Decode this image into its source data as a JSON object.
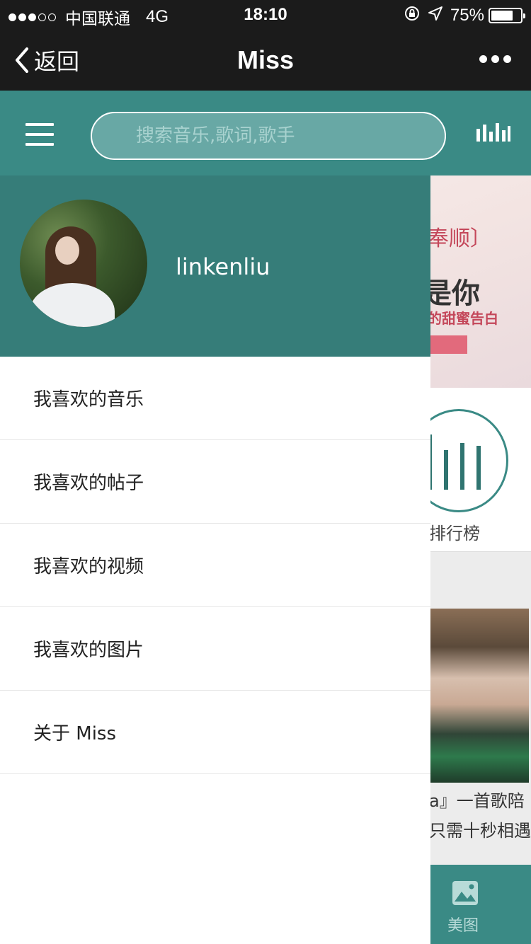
{
  "status_bar": {
    "carrier": "中国联通",
    "network": "4G",
    "time": "18:10",
    "battery": "75%"
  },
  "nav": {
    "back_label": "返回",
    "title": "Miss"
  },
  "header": {
    "search_placeholder": "搜索音乐,歌词,歌手"
  },
  "drawer": {
    "username": "linkenliu",
    "menu_items": [
      {
        "label": "我喜欢的音乐"
      },
      {
        "label": "我喜欢的帖子"
      },
      {
        "label": "我喜欢的视频"
      },
      {
        "label": "我喜欢的图片"
      },
      {
        "label": "关于 Miss"
      }
    ]
  },
  "background_page": {
    "banner_line1": "奉顺〕",
    "banner_line2": "是你",
    "banner_line3": "的甜蜜告白",
    "rank_label": "排行榜",
    "caption_line1": "a』一首歌陪",
    "caption_line2": "只需十秒相遇",
    "tab_label": "美图"
  },
  "colors": {
    "teal": "#3a8a85",
    "teal_dark": "#367d79",
    "nav_bg": "#1b1b1b"
  }
}
